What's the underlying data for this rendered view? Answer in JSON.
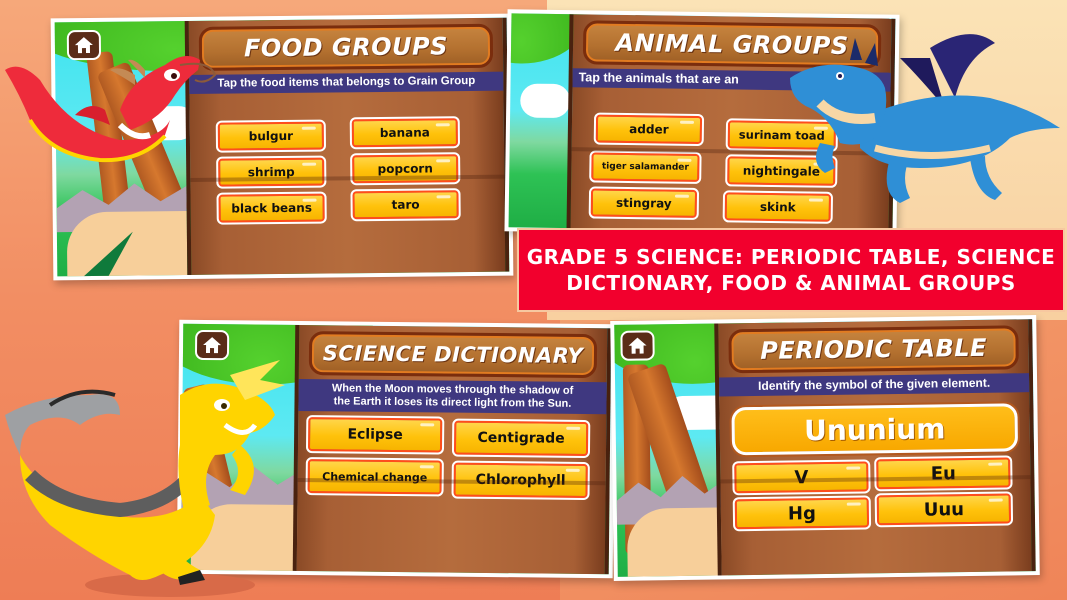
{
  "banner": {
    "text": "GRADE 5 SCIENCE: PERIODIC TABLE, SCIENCE DICTIONARY, FOOD & ANIMAL GROUPS"
  },
  "screens": {
    "food_groups": {
      "title": "FOOD GROUPS",
      "prompt": "Tap the food items that belongs to Grain Group",
      "options": [
        "bulgur",
        "banana",
        "shrimp",
        "popcorn",
        "black beans",
        "taro"
      ],
      "home_icon": "home-icon"
    },
    "animal_groups": {
      "title": "ANIMAL GROUPS",
      "prompt": "Tap the animals that are an",
      "options": [
        "adder",
        "surinam toad",
        "tiger salamander",
        "nightingale",
        "stingray",
        "skink"
      ]
    },
    "science_dictionary": {
      "title": "SCIENCE DICTIONARY",
      "prompt_line1": "When the Moon moves through the shadow of",
      "prompt_line2": "the Earth it loses its direct light from the Sun.",
      "options": [
        "Eclipse",
        "Centigrade",
        "Chemical change",
        "Chlorophyll"
      ],
      "home_icon": "home-icon"
    },
    "periodic_table": {
      "title": "PERIODIC TABLE",
      "prompt": "Identify the symbol of the given element.",
      "element": "Ununium",
      "options": [
        "V",
        "Eu",
        "Hg",
        "Uuu"
      ],
      "home_icon": "home-icon"
    }
  },
  "colors": {
    "banner_bg": "#f2002d",
    "option_fill": "#ffc20b",
    "option_border": "#ff4d1c",
    "prompt_bar": "#3f3880",
    "board_wood": "#b56c3d"
  },
  "characters": [
    "red-dragon",
    "blue-dragon",
    "yellow-dragon"
  ]
}
